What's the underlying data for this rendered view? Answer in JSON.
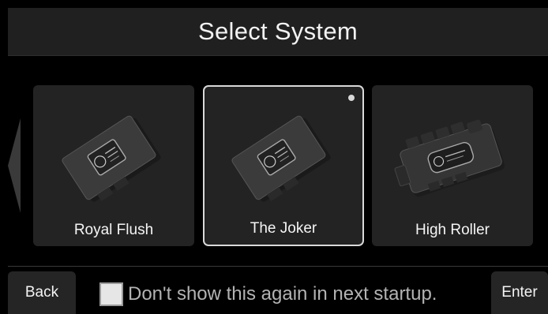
{
  "header": {
    "title": "Select System"
  },
  "systems": [
    {
      "label": "Royal Flush",
      "selected": false,
      "device_icon": "controller-module-icon"
    },
    {
      "label": "The Joker",
      "selected": true,
      "device_icon": "controller-module-icon"
    },
    {
      "label": "High Roller",
      "selected": false,
      "device_icon": "high-roller-module-icon"
    }
  ],
  "footer": {
    "back_label": "Back",
    "enter_label": "Enter",
    "startup_checkbox_label": "Don't show this again in next startup.",
    "startup_checkbox_checked": false
  },
  "colors": {
    "background": "#000000",
    "card": "#232323",
    "selected_border": "#d9d9d9",
    "button": "#252525"
  }
}
